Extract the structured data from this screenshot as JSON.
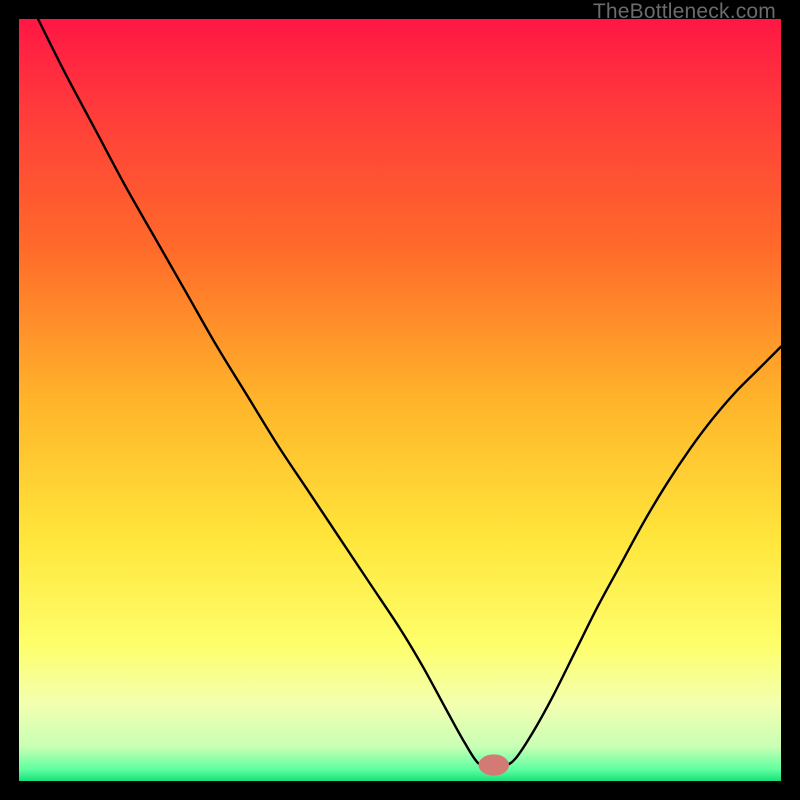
{
  "watermark": "TheBottleneck.com",
  "chart_data": {
    "type": "line",
    "title": "",
    "xlabel": "",
    "ylabel": "",
    "xlim": [
      0,
      100
    ],
    "ylim": [
      0,
      100
    ],
    "grid": false,
    "legend": false,
    "gradient_stops": [
      {
        "offset": 0.0,
        "color": "#ff1744"
      },
      {
        "offset": 0.12,
        "color": "#ff3b3b"
      },
      {
        "offset": 0.3,
        "color": "#ff6a2a"
      },
      {
        "offset": 0.5,
        "color": "#ffb42a"
      },
      {
        "offset": 0.68,
        "color": "#ffe53b"
      },
      {
        "offset": 0.82,
        "color": "#feff6a"
      },
      {
        "offset": 0.9,
        "color": "#f2ffb0"
      },
      {
        "offset": 0.955,
        "color": "#c8ffb4"
      },
      {
        "offset": 0.985,
        "color": "#5effa0"
      },
      {
        "offset": 1.0,
        "color": "#18e07a"
      }
    ],
    "marker": {
      "x": 62.3,
      "y": 2.1,
      "color": "#d47a74",
      "rx": 2.0,
      "ry": 1.4
    },
    "curve_points": [
      {
        "x": 2.5,
        "y": 100.0
      },
      {
        "x": 6.0,
        "y": 93.0
      },
      {
        "x": 10.0,
        "y": 85.5
      },
      {
        "x": 14.0,
        "y": 78.0
      },
      {
        "x": 18.0,
        "y": 71.0
      },
      {
        "x": 22.0,
        "y": 64.0
      },
      {
        "x": 26.0,
        "y": 57.0
      },
      {
        "x": 30.0,
        "y": 50.5
      },
      {
        "x": 34.0,
        "y": 44.0
      },
      {
        "x": 38.0,
        "y": 38.0
      },
      {
        "x": 42.0,
        "y": 32.0
      },
      {
        "x": 46.0,
        "y": 26.0
      },
      {
        "x": 50.0,
        "y": 20.0
      },
      {
        "x": 53.0,
        "y": 15.0
      },
      {
        "x": 56.0,
        "y": 9.5
      },
      {
        "x": 58.5,
        "y": 5.0
      },
      {
        "x": 60.3,
        "y": 2.3
      },
      {
        "x": 62.0,
        "y": 1.9
      },
      {
        "x": 63.7,
        "y": 2.0
      },
      {
        "x": 65.2,
        "y": 3.0
      },
      {
        "x": 67.5,
        "y": 6.5
      },
      {
        "x": 70.0,
        "y": 11.0
      },
      {
        "x": 73.0,
        "y": 17.0
      },
      {
        "x": 76.0,
        "y": 23.0
      },
      {
        "x": 79.0,
        "y": 28.5
      },
      {
        "x": 82.0,
        "y": 34.0
      },
      {
        "x": 85.0,
        "y": 39.0
      },
      {
        "x": 88.0,
        "y": 43.5
      },
      {
        "x": 91.0,
        "y": 47.5
      },
      {
        "x": 94.0,
        "y": 51.0
      },
      {
        "x": 97.0,
        "y": 54.0
      },
      {
        "x": 100.0,
        "y": 57.0
      }
    ]
  }
}
